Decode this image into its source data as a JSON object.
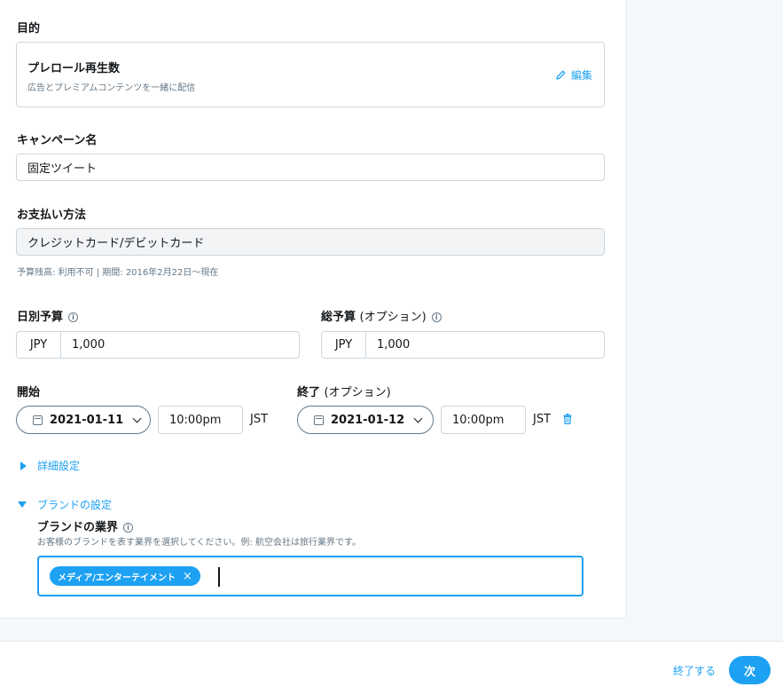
{
  "objective": {
    "label": "目的",
    "title": "プレロール再生数",
    "description": "広告とプレミアムコンテンツを一緒に配信",
    "edit_label": "編集"
  },
  "campaign_name": {
    "label": "キャンペーン名",
    "value": "固定ツイート"
  },
  "payment": {
    "label": "お支払い方法",
    "value": "クレジットカード/デビットカード",
    "note": "予算残高: 利用不可 | 期間: 2016年2月22日〜現在"
  },
  "daily_budget": {
    "label": "日別予算",
    "currency": "JPY",
    "amount": "1,000"
  },
  "total_budget": {
    "label": "総予算",
    "label_optional": "(オプション)",
    "currency": "JPY",
    "amount": "1,000"
  },
  "start": {
    "label": "開始",
    "date": "2021-01-11",
    "time": "10:00pm",
    "tz": "JST"
  },
  "end": {
    "label": "終了",
    "label_optional": "(オプション)",
    "date": "2021-01-12",
    "time": "10:00pm",
    "tz": "JST"
  },
  "advanced": {
    "label": "詳細設定"
  },
  "brand": {
    "section_label": "ブランドの設定",
    "industry_label": "ブランドの業界",
    "industry_help": "お客様のブランドを表す業界を選択してください。例: 航空会社は旅行業界です。",
    "selected_tag": "メディア/エンターテイメント",
    "remove_glyph": "×"
  },
  "footer": {
    "end_label": "終了する",
    "next_label": "次"
  },
  "info_glyph": "i",
  "colors": {
    "accent": "#1da1f2",
    "text": "#14171a",
    "muted": "#657786",
    "border": "#ccd6dd"
  }
}
